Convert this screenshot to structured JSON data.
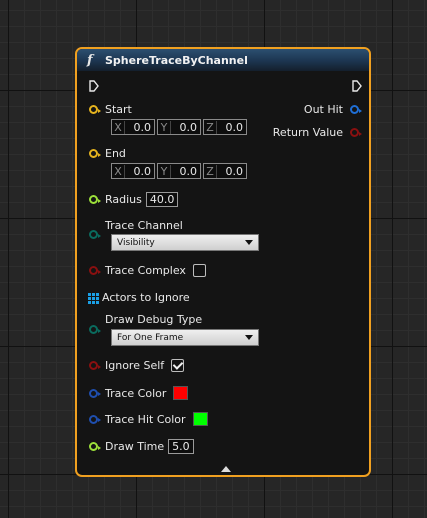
{
  "node": {
    "title": "SphereTraceByChannel",
    "function_icon": "f",
    "border_color": "#f0a020",
    "header_color": "#2c4f70"
  },
  "pins": {
    "start": {
      "label": "Start",
      "x_axis": "X",
      "x": "0.0",
      "y_axis": "Y",
      "y": "0.0",
      "z_axis": "Z",
      "z": "0.0",
      "color": "#e6b41e"
    },
    "end": {
      "label": "End",
      "x_axis": "X",
      "x": "0.0",
      "y_axis": "Y",
      "y": "0.0",
      "z_axis": "Z",
      "z": "0.0",
      "color": "#e6b41e"
    },
    "radius": {
      "label": "Radius",
      "value": "40.0",
      "color": "#9ce03a"
    },
    "trace_channel": {
      "label": "Trace Channel",
      "value": "Visibility",
      "color": "#0a6b5e"
    },
    "trace_complex": {
      "label": "Trace Complex",
      "checked": false,
      "color": "#8a1010"
    },
    "actors_to_ignore": {
      "label": "Actors to Ignore",
      "icon": "array-icon",
      "color": "#1ba0e6"
    },
    "draw_debug_type": {
      "label": "Draw Debug Type",
      "value": "For One Frame",
      "color": "#0a6b5e"
    },
    "ignore_self": {
      "label": "Ignore Self",
      "checked": true,
      "color": "#8a1010"
    },
    "trace_color": {
      "label": "Trace Color",
      "swatch": "#ff0000",
      "color": "#1f4fb0"
    },
    "trace_hit_color": {
      "label": "Trace Hit Color",
      "swatch": "#00ff00",
      "color": "#1f4fb0"
    },
    "draw_time": {
      "label": "Draw Time",
      "value": "5.0",
      "color": "#9ce03a"
    },
    "out_hit": {
      "label": "Out Hit",
      "color": "#1f6fd6"
    },
    "return_value": {
      "label": "Return Value",
      "color": "#8a1010"
    }
  },
  "icons": {
    "exec_in": "exec-arrow-icon",
    "exec_out": "exec-arrow-icon",
    "collapse": "collapse-arrow-icon"
  }
}
